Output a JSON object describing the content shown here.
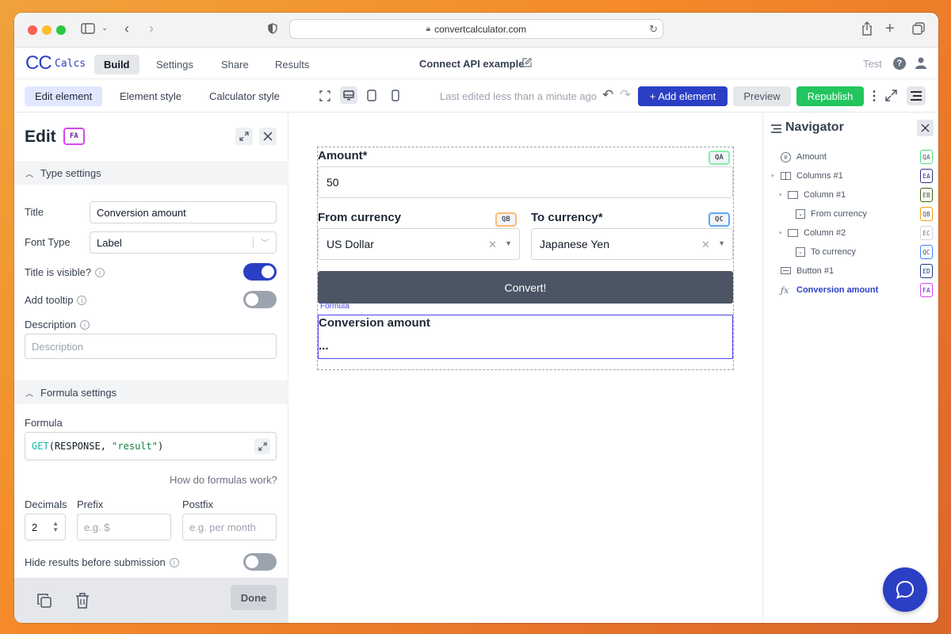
{
  "browser": {
    "url": "convertcalculator.com"
  },
  "app": {
    "logo_cc": "CC",
    "logo_calcs": "Calcs",
    "tabs": [
      "Build",
      "Settings",
      "Share",
      "Results"
    ],
    "title": "Connect API example",
    "user": "Test"
  },
  "toolbar": {
    "edit_element": "Edit element",
    "element_style": "Element style",
    "calculator_style": "Calculator style",
    "last_edited": "Last edited less than a minute ago",
    "add_element": "+ Add element",
    "preview": "Preview",
    "republish": "Republish"
  },
  "edit_panel": {
    "title": "Edit",
    "badge": "FA",
    "type_settings": "Type settings",
    "title_label": "Title",
    "title_value": "Conversion amount",
    "font_type_label": "Font Type",
    "font_type_value": "Label",
    "title_visible_label": "Title is visible?",
    "add_tooltip_label": "Add tooltip",
    "description_label": "Description",
    "description_placeholder": "Description",
    "formula_settings": "Formula settings",
    "formula_label": "Formula",
    "formula_fn": "GET",
    "formula_args": "(RESPONSE, ",
    "formula_str": "\"result\"",
    "formula_close": ")",
    "how_formulas": "How do formulas work?",
    "decimals_label": "Decimals",
    "decimals_value": "2",
    "prefix_label": "Prefix",
    "prefix_placeholder": "e.g. $",
    "postfix_label": "Postfix",
    "postfix_placeholder": "e.g. per month",
    "hide_results_label": "Hide results before submission",
    "done": "Done",
    "toggles": {
      "title_visible": true,
      "add_tooltip": false,
      "hide_results": false
    }
  },
  "calculator": {
    "amount_label": "Amount*",
    "amount_badge": "QA",
    "amount_value": "50",
    "from_label": "From currency",
    "from_badge": "QB",
    "from_value": "US Dollar",
    "to_label": "To currency*",
    "to_badge": "QC",
    "to_value": "Japanese Yen",
    "convert_button": "Convert!",
    "formula_tag": "Formula",
    "result_label": "Conversion amount",
    "result_value": "..."
  },
  "navigator": {
    "title": "Navigator",
    "items": [
      {
        "label": "Amount",
        "badge": "QA",
        "color": "#4ade80"
      },
      {
        "label": "Columns #1",
        "badge": "EA",
        "color": "#312e81"
      },
      {
        "label": "Column #1",
        "badge": "EB",
        "color": "#3f6212"
      },
      {
        "label": "From currency",
        "badge": "QB",
        "color": "#f59e0b"
      },
      {
        "label": "Column #2",
        "badge": "EC",
        "color": "#d1d5db"
      },
      {
        "label": "To currency",
        "badge": "QC",
        "color": "#3b82f6"
      },
      {
        "label": "Button #1",
        "badge": "ED",
        "color": "#1e3a8a"
      },
      {
        "label": "Conversion amount",
        "badge": "FA",
        "color": "#d946ef"
      }
    ]
  },
  "colors": {
    "primary": "#2b3fc5",
    "republish": "#22c55e",
    "convert": "#4b5563"
  }
}
